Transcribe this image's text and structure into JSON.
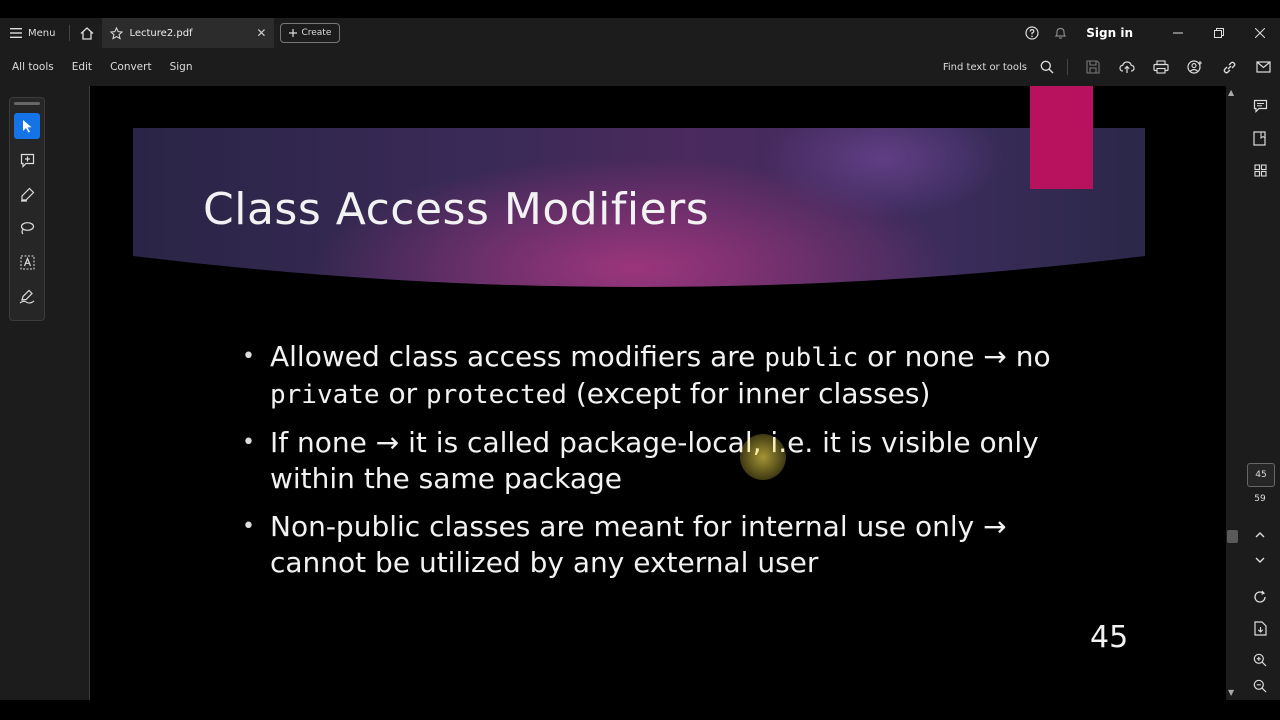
{
  "titlebar": {
    "menu_label": "Menu",
    "tab_title": "Lecture2.pdf",
    "tab_close": "✕",
    "create_label": "Create",
    "sign_in": "Sign in"
  },
  "toolbar": {
    "items": [
      "All tools",
      "Edit",
      "Convert",
      "Sign"
    ],
    "find_label": "Find text or tools"
  },
  "slide": {
    "title": "Class Access Modifiers",
    "bullet1": {
      "t1": "Allowed class access modifiers are ",
      "code1": "public",
      "t2": " or none → no ",
      "code2": "private",
      "t3": " or ",
      "code3": "protected",
      "t4": " (except for inner classes)"
    },
    "bullet2": "If none → it is called package-local, i.e. it is visible only within the same package",
    "bullet3": "Non-public classes are meant for internal use only → cannot be utilized by any external user",
    "number": "45"
  },
  "pager": {
    "current": "45",
    "total": "59"
  },
  "colors": {
    "accent": "#1473e6",
    "magenta": "#b8115e",
    "chrome": "#1c1c1c"
  }
}
